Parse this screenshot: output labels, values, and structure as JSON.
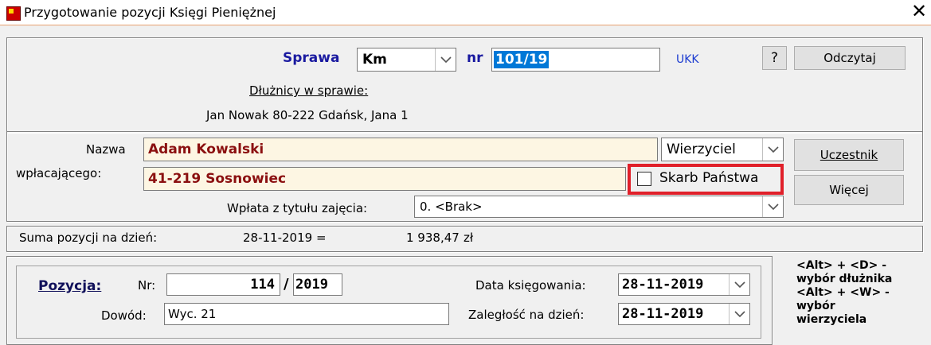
{
  "window": {
    "title": "Przygotowanie pozycji Księgi Pieniężnej",
    "close": "✕"
  },
  "case": {
    "label": "Sprawa",
    "type_value": "Km",
    "nr_label": "nr",
    "nr_value": "101/19",
    "office": "UKK",
    "help": "?",
    "read_button": "Odczytaj",
    "debtors_label": "Dłużnicy w sprawie:",
    "debtor": "Jan Nowak 80-222 Gdańsk, Jana 1"
  },
  "payer": {
    "name_label": "Nazwa",
    "payer_label": "wpłacającego:",
    "name_value": "Adam Kowalski",
    "address_value": "41-219 Sosnowiec",
    "role_value": "Wierzyciel",
    "participant_button": "Uczestnik",
    "more_button": "Więcej",
    "treasury_label": "Skarb Państwa",
    "treasury_checked": false,
    "title_label": "Wpłata z tytułu zajęcia:",
    "title_value": "0. <Brak>"
  },
  "sum": {
    "label": "Suma pozycji na dzień:",
    "date": "28-11-2019 =",
    "amount": "1 938,47",
    "currency": "zł"
  },
  "position": {
    "label": "Pozycja:",
    "nr_label": "Nr:",
    "nr_value": "114",
    "slash": "/",
    "year_value": "2019",
    "proof_label": "Dowód:",
    "proof_value": "Wyc. 21",
    "booking_label": "Data księgowania:",
    "booking_value": "28-11-2019",
    "arrears_label": "Zaległość na dzień:",
    "arrears_value": "28-11-2019"
  },
  "hints": {
    "line1": "<Alt> + <D> -",
    "line2": "wybór dłużnika",
    "line3": "<Alt> + <W> -",
    "line4": "wybór",
    "line5": "wierzyciela"
  },
  "colors": {
    "highlight": "#e0202a",
    "selection": "#0078d7",
    "accent_blue": "#1a1aa0"
  }
}
